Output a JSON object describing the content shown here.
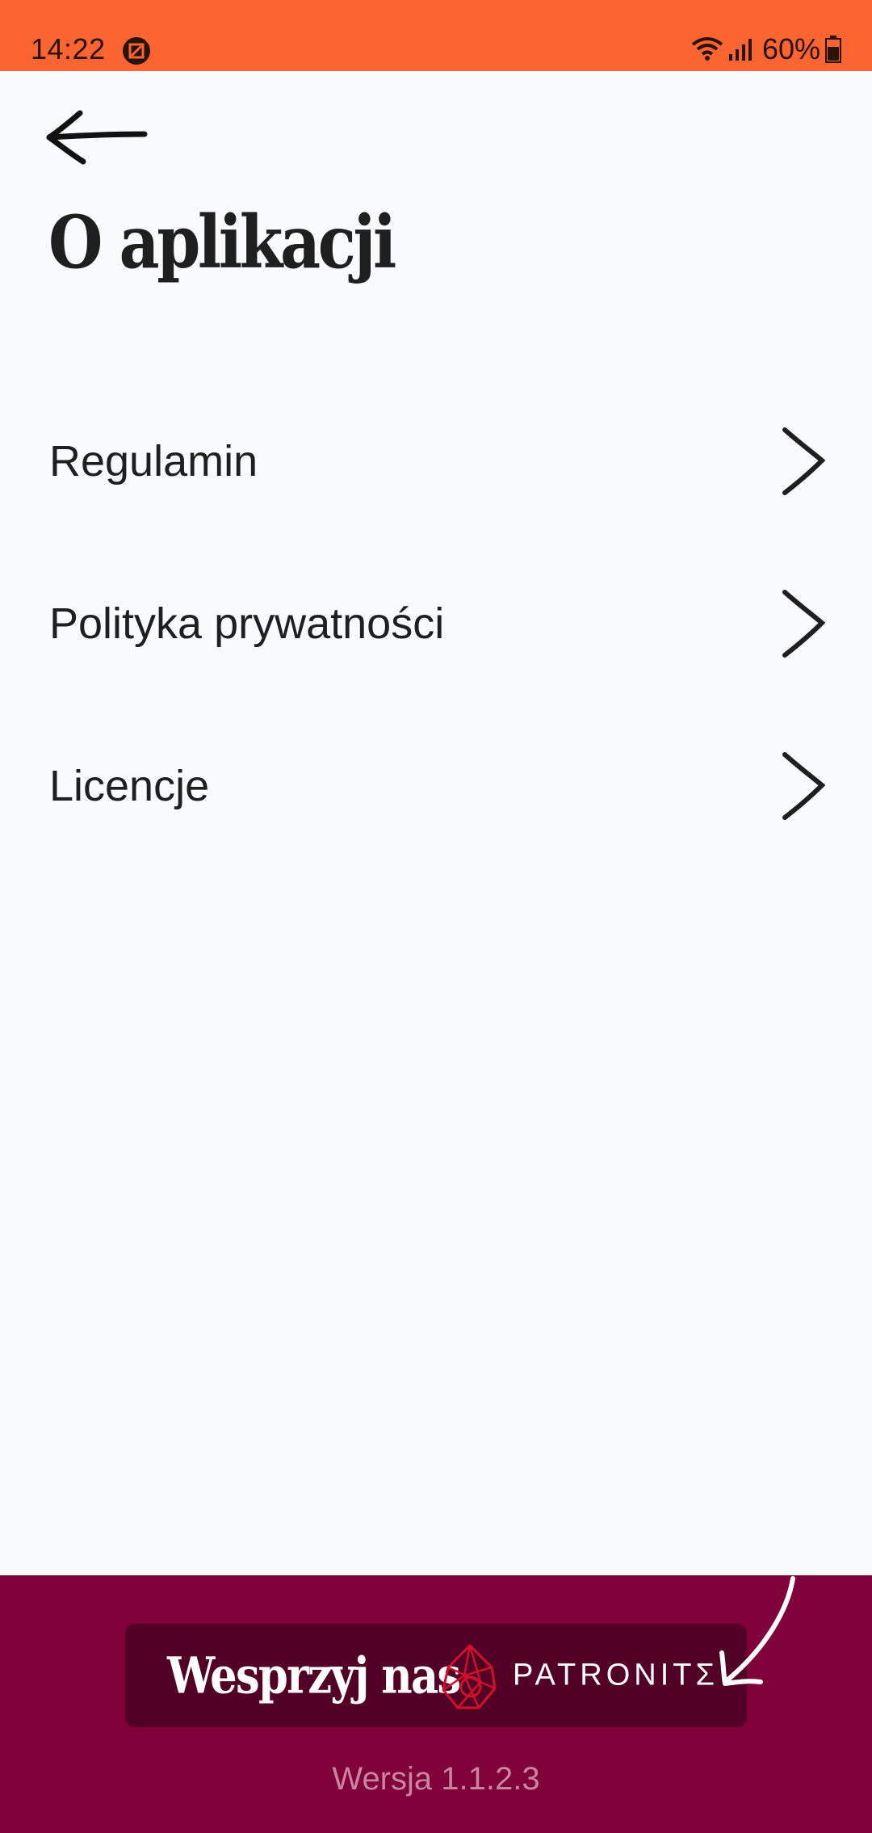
{
  "status_bar": {
    "time": "14:22",
    "battery": "60%",
    "icons": [
      "screen-record-icon",
      "wifi-icon",
      "signal-icon",
      "battery-icon"
    ]
  },
  "header": {
    "back_icon": "arrow-left-icon",
    "title": "O aplikacji"
  },
  "menu": {
    "items": [
      {
        "label": "Regulamin"
      },
      {
        "label": "Polityka prywatności"
      },
      {
        "label": "Licencje"
      }
    ]
  },
  "footer": {
    "support_label": "Wesprzyj nas",
    "partner_name": "PATRONITΣ",
    "version": "Wersja 1.1.2.3"
  },
  "colors": {
    "status_bar": "#fb6531",
    "background": "#f9fafc",
    "footer": "#800039",
    "button": "#520026",
    "logo_red": "#d1102a"
  }
}
